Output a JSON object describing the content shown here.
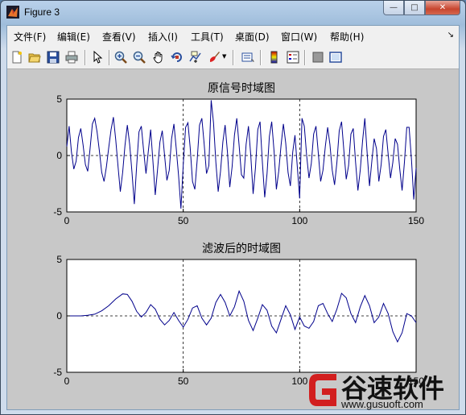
{
  "window": {
    "title": "Figure 3",
    "minimize": "—",
    "maximize": "□",
    "close": "✕"
  },
  "menu": {
    "items": [
      "文件(F)",
      "编辑(E)",
      "查看(V)",
      "插入(I)",
      "工具(T)",
      "桌面(D)",
      "窗口(W)",
      "帮助(H)"
    ],
    "overflow_arrow": "↘"
  },
  "toolbar": {
    "icons": [
      "new-figure-icon",
      "open-file-icon",
      "save-icon",
      "print-icon",
      "pointer-icon",
      "zoom-in-icon",
      "zoom-out-icon",
      "pan-hand-icon",
      "rotate-3d-icon",
      "data-cursor-icon",
      "brush-icon",
      "link-plot-icon",
      "colorbar-icon",
      "legend-icon",
      "hide-plot-tools-icon",
      "show-plot-tools-icon"
    ]
  },
  "colors": {
    "signal": "#00008b",
    "axes_bg": "#ffffff",
    "figure_bg": "#c8c8c8"
  },
  "chart_data": [
    {
      "type": "line",
      "title": "原信号时域图",
      "xlim": [
        0,
        150
      ],
      "ylim": [
        -5,
        5
      ],
      "xticks": [
        0,
        50,
        100,
        150
      ],
      "yticks": [
        -5,
        0,
        5
      ],
      "grid": "dashed lines at x=50, x=100 and y=0",
      "series": [
        {
          "x": [
            0,
            1,
            2,
            3,
            4,
            5,
            6,
            7,
            8,
            9,
            10,
            11,
            12,
            13,
            14,
            15,
            16,
            17,
            18,
            19,
            20,
            21,
            22,
            23,
            24,
            25,
            26,
            27,
            28,
            29,
            30,
            31,
            32,
            33,
            34,
            35,
            36,
            37,
            38,
            39,
            40,
            41,
            42,
            43,
            44,
            45,
            46,
            47,
            48,
            49,
            50,
            51,
            52,
            53,
            54,
            55,
            56,
            57,
            58,
            59,
            60,
            61,
            62,
            63,
            64,
            65,
            66,
            67,
            68,
            69,
            70,
            71,
            72,
            73,
            74,
            75,
            76,
            77,
            78,
            79,
            80,
            81,
            82,
            83,
            84,
            85,
            86,
            87,
            88,
            89,
            90,
            91,
            92,
            93,
            94,
            95,
            96,
            97,
            98,
            99,
            100,
            101,
            102,
            103,
            104,
            105,
            106,
            107,
            108,
            109,
            110,
            111,
            112,
            113,
            114,
            115,
            116,
            117,
            118,
            119,
            120,
            121,
            122,
            123,
            124,
            125,
            126,
            127,
            128,
            129,
            130,
            131,
            132,
            133,
            134,
            135,
            136,
            137,
            138,
            139,
            140,
            141,
            142,
            143,
            144,
            145,
            146,
            147,
            148,
            149,
            150
          ],
          "y": [
            0.8,
            2.6,
            0.3,
            -1.2,
            -0.5,
            1.6,
            2.4,
            0.9,
            -0.8,
            -1.4,
            0.6,
            2.8,
            3.3,
            2.1,
            0.4,
            -1.5,
            -2.3,
            -1.0,
            0.7,
            2.3,
            3.4,
            1.4,
            -1.0,
            -3.2,
            -1.5,
            0.9,
            2.7,
            1.0,
            -1.5,
            -4.3,
            -0.9,
            2.1,
            2.6,
            0.4,
            -1.6,
            0.4,
            2.3,
            -0.6,
            -3.5,
            -1.2,
            1.2,
            2.2,
            0.0,
            -2.2,
            -1.3,
            1.5,
            2.8,
            0.6,
            -1.8,
            -4.7,
            -0.8,
            2.5,
            2.9,
            0.7,
            -2.3,
            -3.0,
            -0.4,
            2.7,
            3.3,
            1.0,
            -1.6,
            -0.9,
            4.9,
            2.9,
            -0.6,
            -3.2,
            -1.4,
            1.2,
            2.7,
            0.3,
            -2.8,
            -1.0,
            1.8,
            3.3,
            0.9,
            -1.7,
            -2.0,
            1.0,
            2.6,
            0.0,
            -3.4,
            -1.1,
            2.3,
            3.0,
            -0.6,
            -3.7,
            -1.6,
            1.7,
            3.0,
            0.4,
            -3.0,
            -1.4,
            0.9,
            2.8,
            1.1,
            -1.5,
            -2.7,
            0.3,
            1.8,
            -1.0,
            -3.8,
            3.3,
            2.6,
            0.0,
            -2.0,
            -0.7,
            1.9,
            2.6,
            0.2,
            -2.3,
            -1.3,
            0.8,
            2.5,
            1.0,
            -1.3,
            -2.6,
            -0.6,
            2.2,
            3.0,
            0.4,
            -2.1,
            -0.9,
            1.9,
            2.4,
            -0.6,
            -3.1,
            -1.3,
            1.3,
            3.3,
            0.2,
            -2.7,
            -0.5,
            1.5,
            0.6,
            -2.3,
            -0.8,
            1.7,
            2.3,
            0.1,
            -2.0,
            -0.6,
            1.5,
            1.0,
            -1.2,
            -3.1,
            -0.6,
            2.5,
            2.5,
            -0.3,
            -3.9,
            -1.1
          ]
        }
      ]
    },
    {
      "type": "line",
      "title": "滤波后的时域图",
      "xlim": [
        0,
        150
      ],
      "ylim": [
        -5,
        5
      ],
      "xticks": [
        0,
        50,
        100,
        150
      ],
      "yticks": [
        -5,
        0,
        5
      ],
      "grid": "dashed lines at x=50, x=100 and y=0",
      "series": [
        {
          "x": [
            0,
            3,
            6,
            9,
            12,
            15,
            18,
            21,
            24,
            26,
            28,
            30,
            32,
            34,
            36,
            38,
            40,
            42,
            44,
            46,
            48,
            50,
            52,
            54,
            56,
            58,
            60,
            62,
            64,
            66,
            68,
            70,
            72,
            74,
            76,
            78,
            80,
            82,
            84,
            86,
            88,
            90,
            92,
            94,
            96,
            98,
            100,
            102,
            104,
            106,
            108,
            110,
            112,
            114,
            116,
            118,
            120,
            122,
            124,
            126,
            128,
            130,
            132,
            134,
            136,
            138,
            140,
            142,
            144,
            146,
            148,
            150
          ],
          "y": [
            0,
            0,
            0,
            0.05,
            0.15,
            0.45,
            0.9,
            1.5,
            1.95,
            1.9,
            1.3,
            0.4,
            -0.1,
            0.3,
            1.0,
            0.6,
            -0.3,
            -0.8,
            -0.4,
            0.3,
            -0.4,
            -1.0,
            -0.3,
            0.7,
            0.9,
            -0.2,
            -0.8,
            -0.2,
            1.2,
            1.9,
            1.2,
            0.0,
            0.8,
            2.2,
            1.3,
            -0.4,
            -1.3,
            -0.2,
            1.0,
            0.5,
            -0.9,
            -1.5,
            -0.3,
            0.9,
            0.1,
            -1.2,
            -0.1,
            -0.9,
            -1.1,
            -0.5,
            0.9,
            1.1,
            0.2,
            -0.5,
            0.6,
            2.0,
            1.6,
            0.2,
            -0.6,
            0.8,
            1.8,
            0.9,
            -0.6,
            -0.1,
            1.1,
            0.2,
            -1.4,
            -2.3,
            -1.5,
            0.2,
            0.0,
            -0.6
          ]
        }
      ]
    }
  ],
  "watermark": {
    "text": "谷速软件",
    "url": "www.gusuoft.com"
  }
}
